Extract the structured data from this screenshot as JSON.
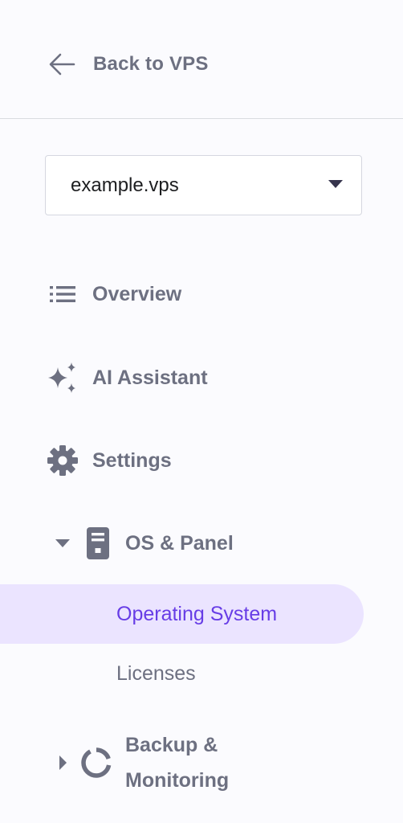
{
  "back": {
    "label": "Back to VPS",
    "icon": "arrow-left-icon"
  },
  "server_select": {
    "value": "example.vps",
    "icon": "caret-down-icon"
  },
  "menu": {
    "overview": {
      "label": "Overview",
      "icon": "list-icon"
    },
    "ai_assistant": {
      "label": "AI Assistant",
      "icon": "sparkles-icon"
    },
    "settings": {
      "label": "Settings",
      "icon": "gear-icon"
    },
    "os_panel": {
      "label": "OS & Panel",
      "icon": "server-icon",
      "expanded": true,
      "children": [
        {
          "label": "Operating System",
          "active": true
        },
        {
          "label": "Licenses",
          "active": false
        }
      ]
    },
    "backup": {
      "label_line1": "Backup &",
      "label_line2": "Monitoring",
      "icon": "monitoring-circle-icon",
      "expanded": false
    }
  },
  "colors": {
    "accent": "#673de6",
    "active_bg": "#ebe4ff",
    "text_muted": "#6d7081"
  }
}
